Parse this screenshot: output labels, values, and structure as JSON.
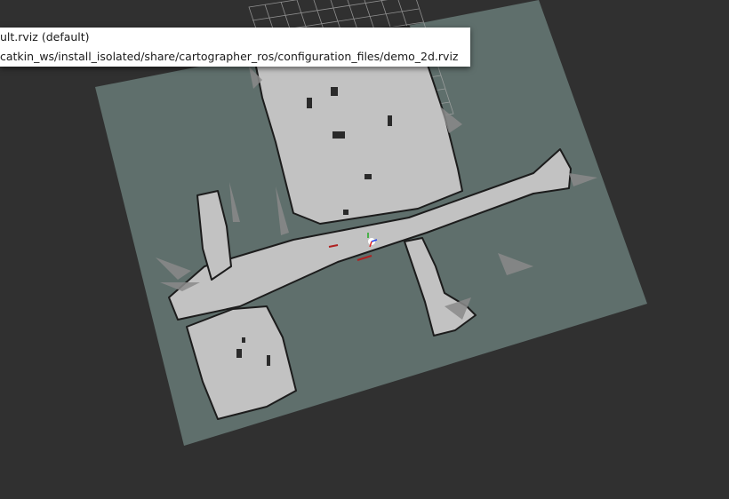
{
  "colors": {
    "background": "#303030",
    "map_unknown": "#5f6f6c",
    "map_free": "#c2c2c2",
    "map_occupied": "#1c1c1c",
    "grid": "#a0a0a0",
    "dropdown_bg": "#ffffff",
    "dropdown_text": "#1a1a1a"
  },
  "dropdown": {
    "items": [
      {
        "label": "ult.rviz (default)"
      },
      {
        "label": "catkin_ws/install_isolated/share/cartographer_ros/configuration_files/demo_2d.rviz"
      }
    ]
  }
}
